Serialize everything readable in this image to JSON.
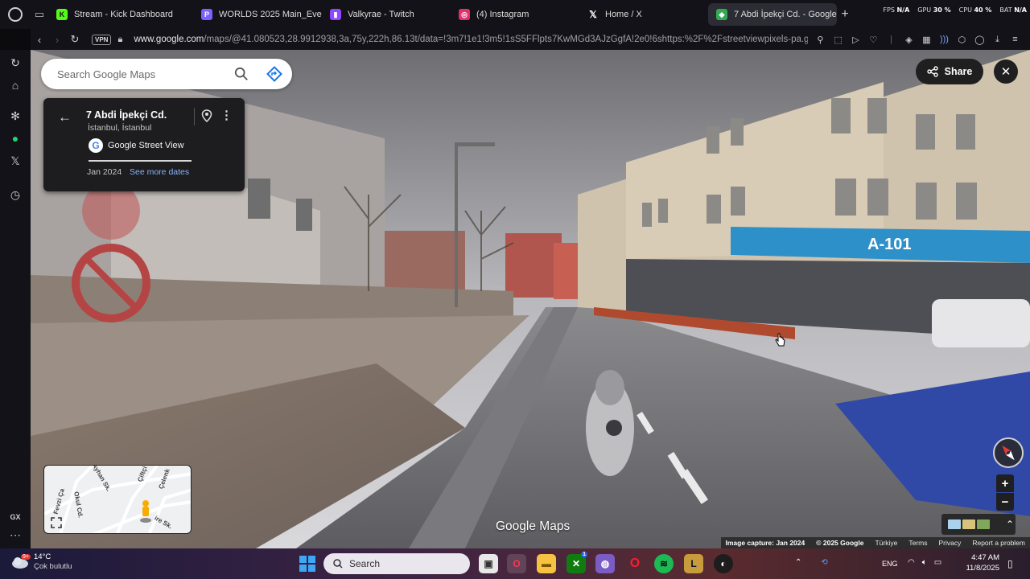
{
  "browser": {
    "tabs": [
      {
        "label": "Stream - Kick Dashboard",
        "icon": "kick-icon",
        "color": "#53fc18"
      },
      {
        "label": "WORLDS 2025 Main_Eve",
        "icon": "docs-icon",
        "color": "#7b61ff"
      },
      {
        "label": "Valkyrae - Twitch",
        "icon": "twitch-icon",
        "color": "#9146ff"
      },
      {
        "label": "(4) Instagram",
        "icon": "instagram-icon",
        "color": "#e1306c"
      },
      {
        "label": "Home / X",
        "icon": "x-icon",
        "color": "#ffffff"
      },
      {
        "label": "7 Abdi İpekçi Cd. - Google",
        "icon": "google-maps-icon",
        "color": "#34a853"
      }
    ],
    "hud": {
      "fps_label": "FPS",
      "fps": "N/A",
      "gpu_label": "GPU",
      "gpu": "30 %",
      "cpu_label": "CPU",
      "cpu": "40 %",
      "bat_label": "BAT",
      "bat": "N/A"
    },
    "vpn_label": "VPN",
    "url_host": "www.google.com",
    "url_path": "/maps/@41.080523,28.9912938,3a,75y,222h,86.13t/data=!3m7!1e1!3m5!1sS5FFlpts7KwMGd3AJzGgfA!2e0!6shttps:%2F%2Fstreetviewpixels-pa.g"
  },
  "sidebar": {
    "gx_label": "GX"
  },
  "maps": {
    "search_placeholder": "Search Google Maps",
    "place_title": "7 Abdi İpekçi Cd.",
    "place_subtitle": "İstanbul, İstanbul",
    "source_label": "Google Street View",
    "capture_date": "Jan 2024",
    "see_more_dates": "See more dates",
    "share_label": "Share",
    "logo_text": "Google Maps",
    "minimap_streets": [
      "Fevzi Ça",
      "Okul Cd.",
      "Ayhan Sk.",
      "Çiftçi",
      "Çelenk",
      "ire Sk."
    ],
    "footer": {
      "capture": "Image capture: Jan 2024",
      "copyright": "© 2025 Google",
      "country": "Türkiye",
      "terms": "Terms",
      "privacy": "Privacy",
      "report": "Report a problem"
    },
    "scene_signs": {
      "shop_sign": "A-101"
    }
  },
  "taskbar": {
    "weather_temp": "14°C",
    "weather_desc": "Çok bulutlu",
    "weather_badge": "9+",
    "search_placeholder": "Search",
    "lang": "ENG",
    "time": "4:47 AM",
    "date": "11/8/2025",
    "xbox_badge": "1"
  }
}
